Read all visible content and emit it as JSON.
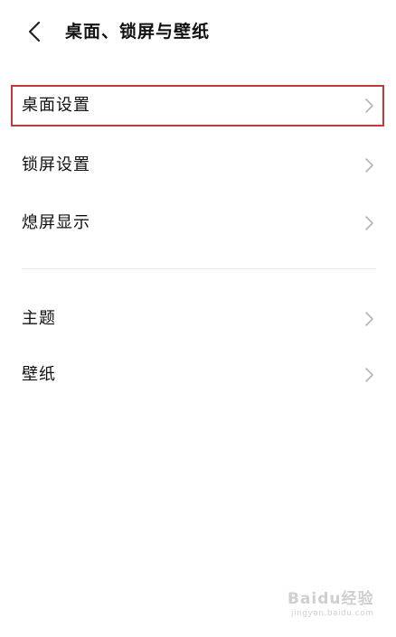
{
  "header": {
    "title": "桌面、锁屏与壁纸",
    "back_icon": "chevron-left-icon"
  },
  "settings": {
    "group1": [
      {
        "label": "桌面设置",
        "icon": "chevron-right-icon",
        "highlighted": true
      },
      {
        "label": "锁屏设置",
        "icon": "chevron-right-icon",
        "highlighted": false
      },
      {
        "label": "熄屏显示",
        "icon": "chevron-right-icon",
        "highlighted": false
      }
    ],
    "group2": [
      {
        "label": "主题",
        "icon": "chevron-right-icon",
        "highlighted": false
      },
      {
        "label": "壁纸",
        "icon": "chevron-right-icon",
        "highlighted": false
      }
    ]
  },
  "highlight_color": "#c03a3a",
  "watermark": {
    "logo_text": "Baidu经验",
    "url_text": "jingyan.baidu.com"
  }
}
